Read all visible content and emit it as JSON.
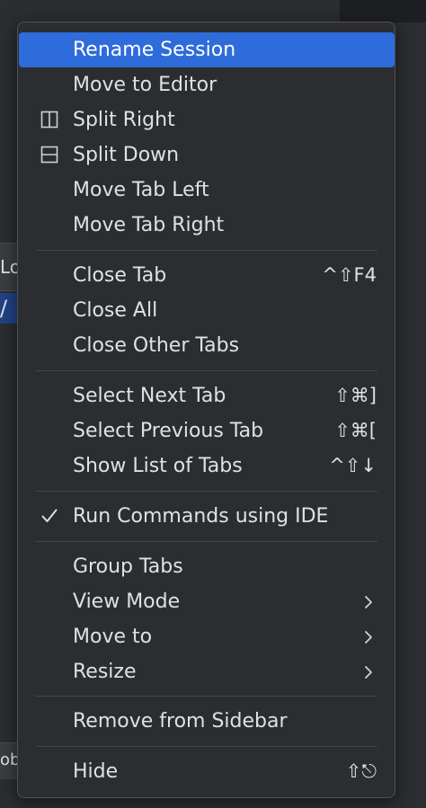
{
  "background": {
    "peek_top": "Lo",
    "peek_selected": "/",
    "peek_bottom": "ob"
  },
  "menu": {
    "items": {
      "rename_session": {
        "label": "Rename Session"
      },
      "move_to_editor": {
        "label": "Move to Editor"
      },
      "split_right": {
        "label": "Split Right",
        "icon": "split-right-icon"
      },
      "split_down": {
        "label": "Split Down",
        "icon": "split-down-icon"
      },
      "move_tab_left": {
        "label": "Move Tab Left"
      },
      "move_tab_right": {
        "label": "Move Tab Right"
      },
      "close_tab": {
        "label": "Close Tab",
        "shortcut": "^⇧F4"
      },
      "close_all": {
        "label": "Close All"
      },
      "close_other_tabs": {
        "label": "Close Other Tabs"
      },
      "select_next_tab": {
        "label": "Select Next Tab",
        "shortcut": "⇧⌘]"
      },
      "select_previous_tab": {
        "label": "Select Previous Tab",
        "shortcut": "⇧⌘["
      },
      "show_list_of_tabs": {
        "label": "Show List of Tabs",
        "shortcut": "^⇧↓"
      },
      "run_commands_using_ide": {
        "label": "Run Commands using IDE",
        "checked": true
      },
      "group_tabs": {
        "label": "Group Tabs"
      },
      "view_mode": {
        "label": "View Mode",
        "submenu": true
      },
      "move_to": {
        "label": "Move to",
        "submenu": true
      },
      "resize": {
        "label": "Resize",
        "submenu": true
      },
      "remove_from_sidebar": {
        "label": "Remove from Sidebar"
      },
      "hide": {
        "label": "Hide",
        "shortcut": "⇧⎋"
      }
    }
  },
  "colors": {
    "menu_background": "#2b2d30",
    "selection": "#2e6bdb",
    "text": "#dfe1e5",
    "separator": "#43454a"
  }
}
